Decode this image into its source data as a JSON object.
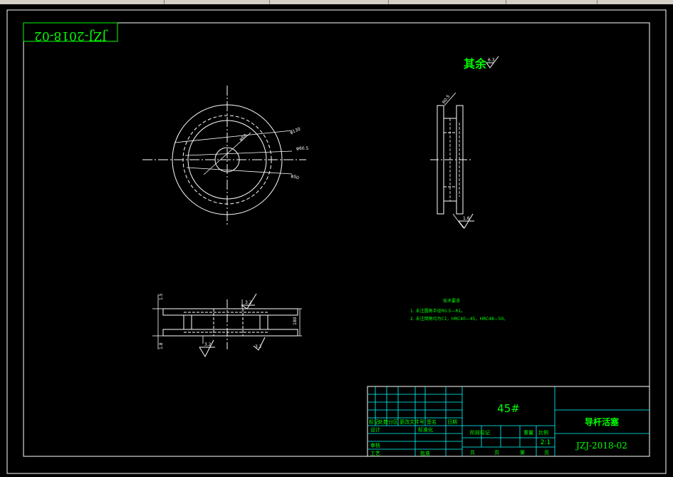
{
  "drawing_number": "JZJ-2018-02",
  "mirrored_stamp": "JZJ-2018-02",
  "roughness_general": {
    "label": "其余",
    "value": "6.3"
  },
  "roughness_marks": [
    "3.2",
    "1.6",
    "3.2",
    "3.2"
  ],
  "dimensions": {
    "front_view": [
      "φ130",
      "φ68",
      "φ60.5",
      "φ50"
    ],
    "side_view": [
      "R0.5"
    ],
    "section_view": [
      "1.5",
      "1.8",
      "180"
    ]
  },
  "technical_requirements": {
    "title": "技术要求",
    "items": [
      "1. 未注圆角半径R0.5—R1。",
      "2. 未注倒角均为C1，HRC40—45，HRC48—50。"
    ]
  },
  "title_block": {
    "material": "45#",
    "part_name": "导杆活塞",
    "drawing_no": "JZJ-2018-02",
    "scale_value": "2:1",
    "headers": {
      "mark": "标记",
      "count": "处数",
      "zone": "分区",
      "change_doc": "更改文件号",
      "signature": "签名",
      "date": "日期",
      "design": "设计",
      "standardization": "标准化",
      "review": "审核",
      "process": "工艺",
      "approve": "批准",
      "stage_mark": "阶段标记",
      "weight": "重量",
      "scale": "比例",
      "total_sheets": "共",
      "sheet": "页",
      "sheet_no": "第",
      "page": "页"
    }
  },
  "colors": {
    "background": "#000000",
    "border": "#ffffff",
    "text_green": "#00ff00",
    "table_lines": "#00ffff",
    "dashed": "#ffffff",
    "chrome": "#d4d0c8"
  }
}
